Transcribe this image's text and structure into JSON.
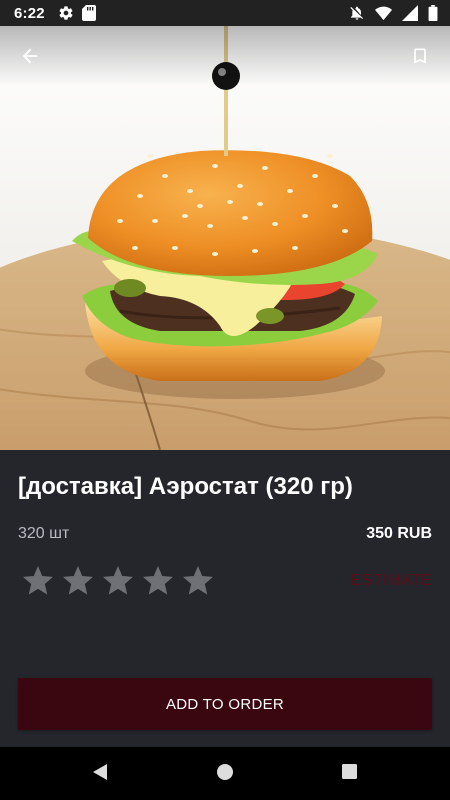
{
  "status_bar": {
    "time": "6:22",
    "icons": [
      "gear-icon",
      "sd-card-icon",
      "notifications-off-icon",
      "wifi-icon",
      "signal-icon",
      "battery-icon"
    ]
  },
  "app_bar": {
    "icons": [
      "back-arrow-icon",
      "bookmark-icon"
    ]
  },
  "product": {
    "title": "[доставка] Аэростат (320 гр)",
    "quantity": "320 шт",
    "price": "350 RUB",
    "rating_value": 0,
    "rating_max": 5
  },
  "actions": {
    "estimate_label": "ESTIMATE",
    "add_to_order_label": "ADD TO ORDER"
  },
  "nav_bar": {
    "icons": [
      "back-triangle-icon",
      "home-circle-icon",
      "recents-square-icon"
    ]
  },
  "colors": {
    "background": "#24262c",
    "star": "#6f7076",
    "estimate": "#5a0e18",
    "button": "#3a0710"
  }
}
